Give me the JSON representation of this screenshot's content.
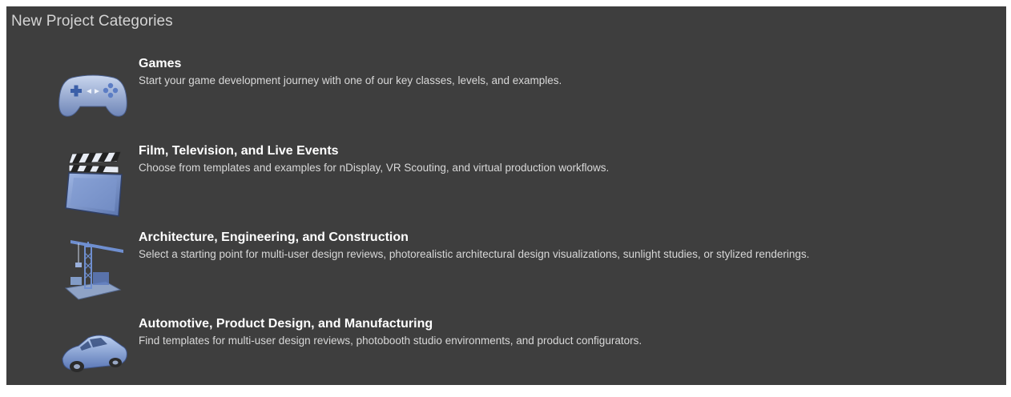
{
  "panel": {
    "title": "New Project Categories"
  },
  "categories": [
    {
      "title": "Games",
      "description": "Start your game development journey with one of our key classes, levels, and examples.",
      "icon": "gamepad-icon"
    },
    {
      "title": "Film, Television, and Live Events",
      "description": "Choose from templates and examples for nDisplay, VR Scouting, and virtual production workflows.",
      "icon": "clapperboard-icon"
    },
    {
      "title": "Architecture, Engineering, and Construction",
      "description": "Select a starting point for multi-user design reviews, photorealistic architectural design visualizations, sunlight studies, or stylized renderings.",
      "icon": "construction-crane-icon"
    },
    {
      "title": "Automotive, Product Design, and Manufacturing",
      "description": "Find templates for multi-user design reviews, photobooth studio environments, and product configurators.",
      "icon": "car-icon"
    }
  ],
  "colors": {
    "panel_background": "#3e3e3e",
    "title_text": "#ffffff",
    "description_text": "#d8d8d8",
    "icon_blue": "#8aa6d6"
  }
}
